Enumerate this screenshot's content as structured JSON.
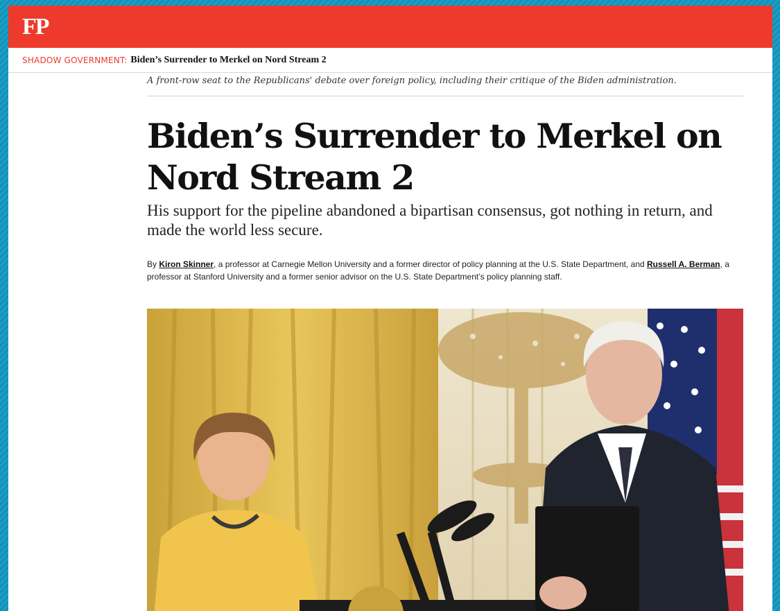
{
  "masthead": {
    "logo": "FP"
  },
  "section": {
    "label": "SHADOW GOVERNMENT:",
    "title": "Biden’s Surrender to Merkel on Nord Stream 2"
  },
  "article": {
    "tagline": "A front-row seat to the Republicans' debate over foreign policy, including their critique of the Biden administration.",
    "headline": "Biden’s Surrender to Merkel on Nord Stream 2",
    "dek": "His support for the pipeline abandoned a bipartisan consensus, got nothing in return, and made the world less secure.",
    "byline": {
      "by": "By ",
      "author1": "Kiron Skinner",
      "author1_desc": ", a professor at Carnegie Mellon University and a former director of policy planning at the U.S. State Department, and ",
      "author2": "Russell A. Berman",
      "author2_desc": ", a professor at Stanford University and a former senior advisor on the U.S. State Department’s policy planning staff."
    }
  },
  "colors": {
    "brand": "#ee3a2c",
    "background": "#1aa0c8"
  },
  "photo": {
    "subject": "news-photo"
  }
}
